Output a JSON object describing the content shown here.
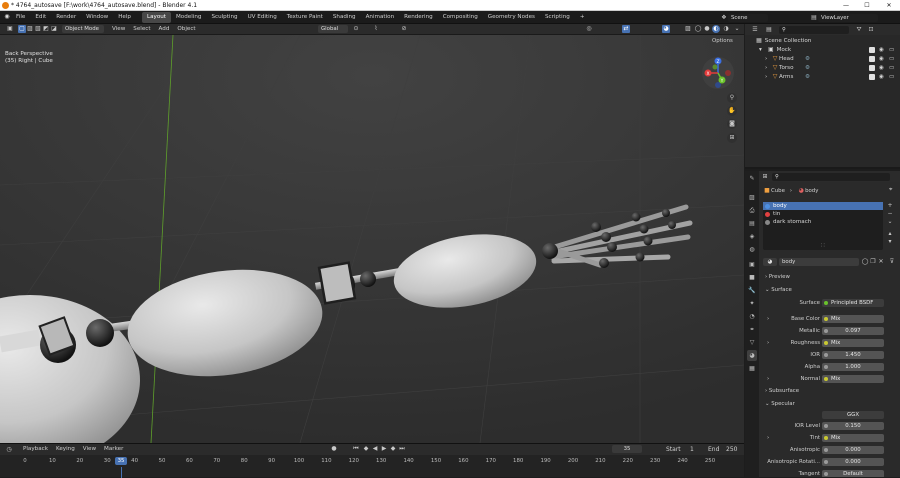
{
  "window": {
    "title": "* 4764_autosave [F:\\work\\4764_autosave.blend] - Blender 4.1",
    "minimize": "—",
    "maximize": "☐",
    "close": "✕"
  },
  "menu": {
    "items": [
      "File",
      "Edit",
      "Render",
      "Window",
      "Help"
    ],
    "workspaces": [
      "Layout",
      "Modeling",
      "Sculpting",
      "UV Editing",
      "Texture Paint",
      "Shading",
      "Animation",
      "Rendering",
      "Compositing",
      "Geometry Nodes",
      "Scripting"
    ],
    "active_workspace": "Layout",
    "add_workspace": "+",
    "scene_label": "Scene",
    "view_layer_label": "ViewLayer"
  },
  "viewport": {
    "mode": "Object Mode",
    "menus": [
      "View",
      "Select",
      "Add",
      "Object"
    ],
    "transform_orientation": "Global",
    "options_label": "Options",
    "view_name": "Back Perspective",
    "object_info": "(35) Right | Cube",
    "gizmo_axes": {
      "x": "X",
      "y": "Y",
      "z": "Z"
    }
  },
  "outliner": {
    "root": "Scene Collection",
    "collection": "Mock",
    "items": [
      "Head",
      "Torso",
      "Arms"
    ]
  },
  "properties": {
    "breadcrumb": [
      "Cube",
      "body"
    ],
    "material_slots": [
      "body",
      "tin",
      "dark stomach"
    ],
    "material_name": "body",
    "panels": {
      "preview": "Preview",
      "surface": "Surface",
      "subsurface": "Subsurface",
      "specular": "Specular"
    },
    "surface_shader": "Principled BSDF",
    "fields": [
      {
        "label": "Base Color",
        "value": "Mix",
        "linked": true
      },
      {
        "label": "Metallic",
        "value": "0.097"
      },
      {
        "label": "Roughness",
        "value": "Mix",
        "linked": true
      },
      {
        "label": "IOR",
        "value": "1.450"
      },
      {
        "label": "Alpha",
        "value": "1.000"
      },
      {
        "label": "Normal",
        "value": "Mix",
        "linked": true
      }
    ],
    "specular_distribution": "GGX",
    "specular_fields": [
      {
        "label": "IOR Level",
        "value": "0.150"
      },
      {
        "label": "Tint",
        "value": "Mix",
        "linked": true
      },
      {
        "label": "Anisotropic",
        "value": "0.000"
      },
      {
        "label": "Anisotropic Rotati...",
        "value": "0.000"
      },
      {
        "label": "Tangent",
        "value": "Default"
      }
    ]
  },
  "timeline": {
    "menus": [
      "Playback",
      "Keying",
      "View",
      "Marker"
    ],
    "current_frame": "35",
    "start_label": "Start",
    "start": "1",
    "end_label": "End",
    "end": "250",
    "ticks": [
      "0",
      "10",
      "20",
      "30",
      "40",
      "50",
      "60",
      "70",
      "80",
      "90",
      "100",
      "110",
      "120",
      "130",
      "140",
      "150",
      "160",
      "170",
      "180",
      "190",
      "200",
      "210",
      "220",
      "230",
      "240",
      "250"
    ],
    "playhead_label": "35"
  },
  "colors": {
    "accent": "#4772b3",
    "x_axis": "#e33a3a",
    "y_axis": "#6ac22b",
    "z_axis": "#3a6fe3"
  }
}
